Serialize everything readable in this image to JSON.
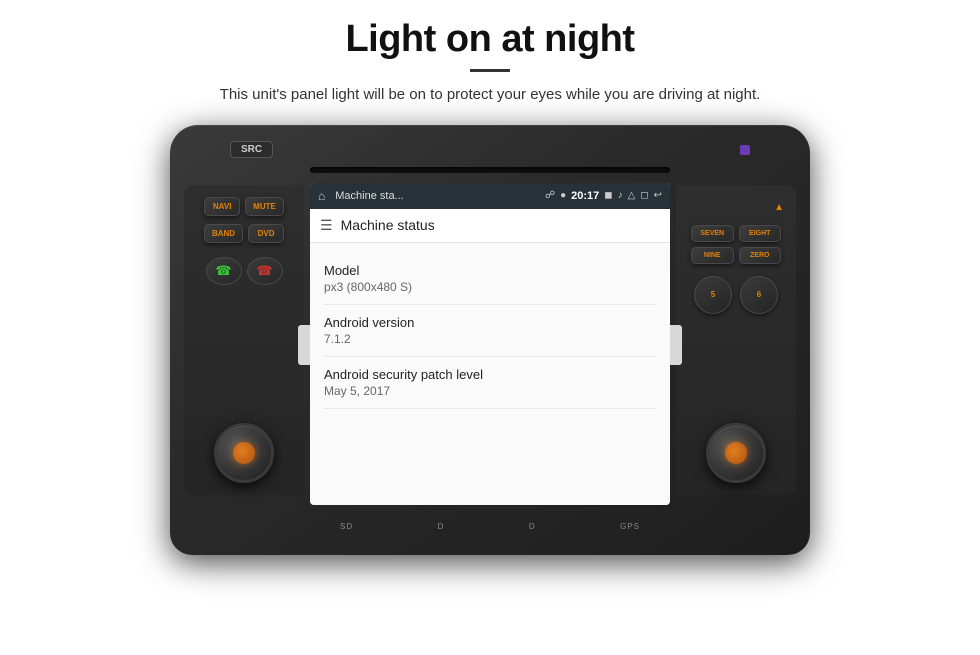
{
  "page": {
    "title": "Light on at night",
    "subtitle": "This unit's panel light will be on to protect your eyes while you are driving at night."
  },
  "unit": {
    "top_button": "SRC",
    "cd_slot_visible": true,
    "left_buttons": [
      "NAVI",
      "MUTE",
      "BAND",
      "DVD"
    ],
    "bottom_slots": [
      "SD",
      "D",
      "D",
      "GPS"
    ]
  },
  "android": {
    "status_bar": {
      "app_name": "Machine sta...",
      "time": "20:17",
      "icons": [
        "msg",
        "pin",
        "photo",
        "vol",
        "cast",
        "screen",
        "back"
      ]
    },
    "toolbar": {
      "title": "Machine status"
    },
    "info_items": [
      {
        "label": "Model",
        "value": "px3 (800x480 S)"
      },
      {
        "label": "Android version",
        "value": "7.1.2"
      },
      {
        "label": "Android security patch level",
        "value": "May 5, 2017"
      }
    ]
  },
  "right_buttons": {
    "top_row": [
      "SEVEN",
      "EIGHT"
    ],
    "mid_row": [
      "NINE",
      "ZERO"
    ],
    "circle_labels": [
      "5",
      "6"
    ]
  }
}
